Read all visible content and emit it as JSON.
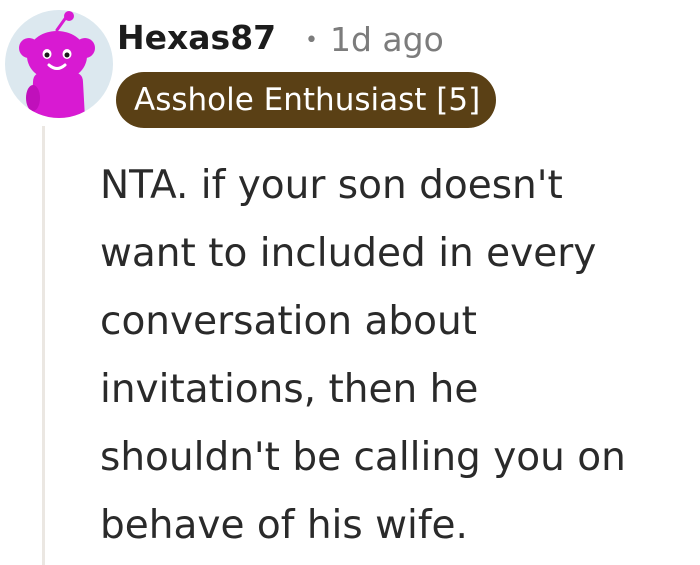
{
  "comment": {
    "author": "Hexas87",
    "separator": "•",
    "timestamp": "1d ago",
    "flair": "Asshole Enthusiast [5]",
    "body_lines": [
      "NTA. if your son doesn't",
      "want to included in every",
      "conversation about",
      "invitations, then he",
      "shouldn't be calling you on",
      "behave of his wife."
    ]
  },
  "avatar": {
    "icon": "snoo-avatar-icon",
    "background_color": "#dce8ef",
    "figure_color": "#d81ad2"
  },
  "colors": {
    "flair_background": "#5a4015",
    "flair_text": "#ffffff",
    "meta_text": "#7c7c7c",
    "thread_line": "#ebe7e2"
  }
}
